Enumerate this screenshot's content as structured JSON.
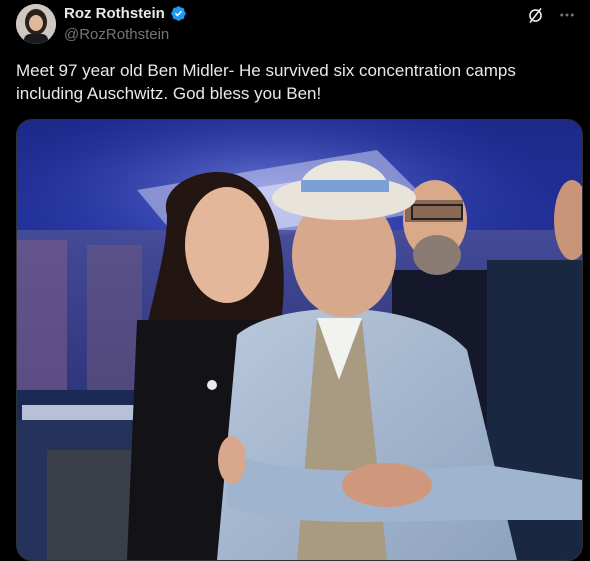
{
  "post": {
    "author": {
      "display_name": "Roz Rothstein",
      "handle": "@RozRothstein",
      "verified": true,
      "avatar_icon": "avatar-photo"
    },
    "text": "Meet 97 year old Ben Midler- He survived six concentration camps including Auschwitz. God bless you Ben!",
    "actions": {
      "grok_icon": "grok-icon",
      "more_icon": "more-options-icon"
    },
    "media": {
      "type": "photo"
    }
  },
  "colors": {
    "background": "#000000",
    "text_primary": "#e7e9ea",
    "text_secondary": "#71767b",
    "verified_blue": "#1d9bf0"
  }
}
